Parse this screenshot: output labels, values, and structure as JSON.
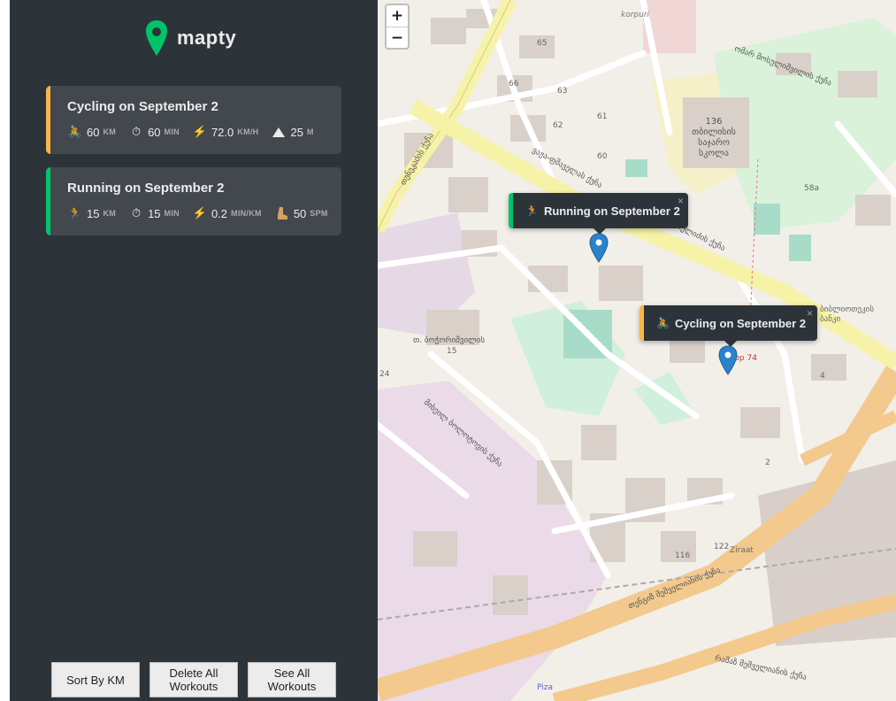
{
  "app": {
    "name": "mapty"
  },
  "colors": {
    "sidebar_bg": "#2d3439",
    "card_bg": "#42484d",
    "cycling": "#ffb545",
    "running": "#00c46a",
    "brand": "#00c46a",
    "marker": "#2b82cb"
  },
  "workouts": [
    {
      "type": "cycling",
      "title": "Cycling on September 2",
      "details": [
        {
          "icon": "bicycle-icon",
          "value": "60",
          "unit": "KM"
        },
        {
          "icon": "stopwatch-icon",
          "value": "60",
          "unit": "MIN"
        },
        {
          "icon": "lightning-icon",
          "value": "72.0",
          "unit": "KM/H"
        },
        {
          "icon": "mountain-icon",
          "value": "25",
          "unit": "M"
        }
      ]
    },
    {
      "type": "running",
      "title": "Running on September 2",
      "details": [
        {
          "icon": "runner-icon",
          "value": "15",
          "unit": "KM"
        },
        {
          "icon": "stopwatch-icon",
          "value": "15",
          "unit": "MIN"
        },
        {
          "icon": "lightning-icon",
          "value": "0.2",
          "unit": "MIN/KM"
        },
        {
          "icon": "footprint-icon",
          "value": "50",
          "unit": "SPM"
        }
      ]
    }
  ],
  "buttons": {
    "sort": "Sort By KM",
    "delete_line1": "Delete All",
    "delete_line2": "Workouts",
    "see_line1": "See All",
    "see_line2": "Workouts"
  },
  "map": {
    "zoom_in": "+",
    "zoom_out": "−",
    "popups": [
      {
        "type": "running",
        "label": "Running on September 2",
        "close": "×"
      },
      {
        "type": "cycling",
        "label": "Cycling on September 2",
        "close": "×"
      }
    ],
    "labels": {
      "korpuri": "korpuri",
      "school": "136 თბილისის საჯარო სკოლა",
      "bank": "ბიბლიოთეკის ბანკი",
      "num_58a": "58a",
      "num_15": "15",
      "num_24": "24",
      "num_116": "116",
      "num_122": "122",
      "num_4": "4",
      "num_2": "2",
      "num_60": "60",
      "num_61": "61",
      "num_62": "62",
      "num_63": "63",
      "num_65": "65",
      "num_66": "66",
      "ziraat": "Ziraat",
      "pizza": "Piza",
      "shop74": "shop 74",
      "street1": "ვაჟა-ფშაველას ქუჩა",
      "street2": "ფანჩულიძის ქუჩა",
      "street3": "თუნუკაძის ქუჩა",
      "street4": "მიხეილ ბოლოტოვის ქუჩა",
      "street5": "თენგიზ მეშველიანის ქუჩა",
      "street6": "რამაზ მეშველიანის ქუჩა",
      "street7": "თ. ბოჭორიშვილის",
      "street8": "ომარ მოსულიშვილის ქუჩა"
    }
  }
}
